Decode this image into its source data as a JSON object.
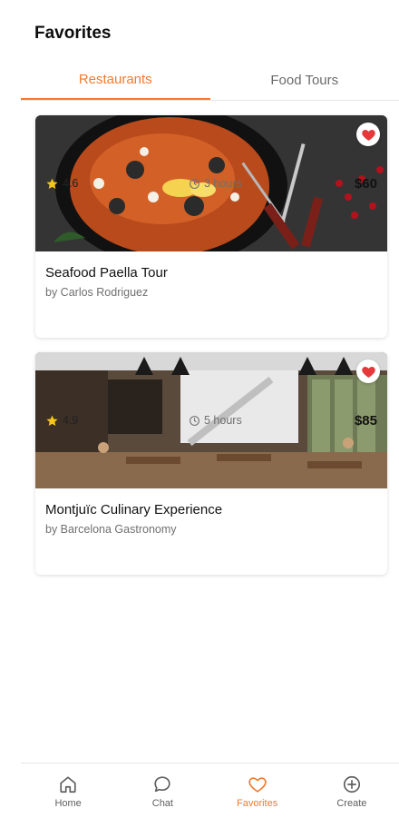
{
  "header": {
    "title": "Favorites"
  },
  "tabs": [
    {
      "label": "Restaurants",
      "active": true
    },
    {
      "label": "Food Tours",
      "active": false
    }
  ],
  "favorites": [
    {
      "title": "Seafood Paella Tour",
      "author": "by Carlos Rodriguez",
      "rating": "4.6",
      "duration": "3 hours",
      "price": "$60",
      "favorited": true,
      "image": "seafood-paella-photo"
    },
    {
      "title": "Montjuïc Culinary Experience",
      "author": "by Barcelona Gastronomy",
      "rating": "4.9",
      "duration": "5 hours",
      "price": "$85",
      "favorited": true,
      "image": "restaurant-interior-photo"
    }
  ],
  "bottom_nav": [
    {
      "label": "Home",
      "icon": "home-icon",
      "active": false
    },
    {
      "label": "Chat",
      "icon": "chat-icon",
      "active": false
    },
    {
      "label": "Favorites",
      "icon": "heart-icon",
      "active": true
    },
    {
      "label": "Create",
      "icon": "plus-circle-icon",
      "active": false
    }
  ],
  "colors": {
    "accent": "#f47a2b",
    "heart": "#e5383b",
    "star": "#f5c518"
  }
}
